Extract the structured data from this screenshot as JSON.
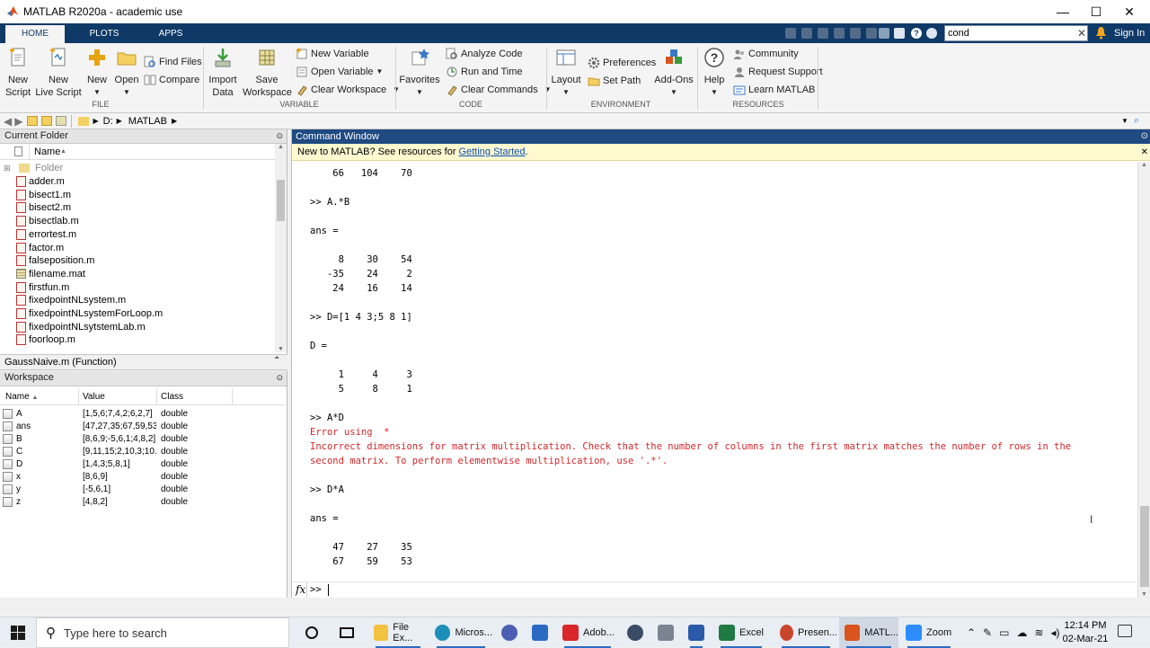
{
  "window": {
    "title": "MATLAB R2020a - academic use"
  },
  "tabs": [
    {
      "label": "HOME"
    },
    {
      "label": "PLOTS"
    },
    {
      "label": "APPS"
    }
  ],
  "search": {
    "value": "cond",
    "signin": "Sign In"
  },
  "ribbon": {
    "new_script": "New\nScript",
    "new_live_script": "New\nLive Script",
    "new": "New",
    "open": "Open",
    "find_files": "Find Files",
    "compare": "Compare",
    "import_data": "Import\nData",
    "save_workspace": "Save\nWorkspace",
    "new_variable": "New Variable",
    "open_variable": "Open Variable",
    "clear_workspace": "Clear Workspace",
    "favorites": "Favorites",
    "analyze_code": "Analyze Code",
    "run_and_time": "Run and Time",
    "clear_commands": "Clear Commands",
    "layout": "Layout",
    "preferences": "Preferences",
    "set_path": "Set Path",
    "addons": "Add-Ons",
    "help": "Help",
    "community": "Community",
    "request_support": "Request Support",
    "learn_matlab": "Learn MATLAB",
    "sections": {
      "file": "FILE",
      "variable": "VARIABLE",
      "code": "CODE",
      "environment": "ENVIRONMENT",
      "resources": "RESOURCES"
    }
  },
  "address": {
    "drive": "D:",
    "folder": "MATLAB"
  },
  "current_folder": {
    "title": "Current Folder",
    "name_col": "Name",
    "folder_item": "Folder",
    "files": [
      "adder.m",
      "bisect1.m",
      "bisect2.m",
      "bisectlab.m",
      "errortest.m",
      "factor.m",
      "falseposition.m",
      "filename.mat",
      "firstfun.m",
      "fixedpointNLsystem.m",
      "fixedpointNLsystemForLoop.m",
      "fixedpointNLsytstemLab.m",
      "foorloop.m"
    ]
  },
  "details": {
    "text": "GaussNaive.m  (Function)"
  },
  "workspace": {
    "title": "Workspace",
    "headers": {
      "name": "Name",
      "value": "Value",
      "class": "Class"
    },
    "vars": [
      {
        "name": "A",
        "value": "[1,5,6;7,4,2;6,2,7]",
        "class": "double"
      },
      {
        "name": "ans",
        "value": "[47,27,35;67,59,53]",
        "class": "double"
      },
      {
        "name": "B",
        "value": "[8,6,9;-5,6,1;4,8,2]",
        "class": "double"
      },
      {
        "name": "C",
        "value": "[9,11,15;2,10,3;10...",
        "class": "double"
      },
      {
        "name": "D",
        "value": "[1,4,3;5,8,1]",
        "class": "double"
      },
      {
        "name": "x",
        "value": "[8,6,9]",
        "class": "double"
      },
      {
        "name": "y",
        "value": "[-5,6,1]",
        "class": "double"
      },
      {
        "name": "z",
        "value": "[4,8,2]",
        "class": "double"
      }
    ]
  },
  "command_window": {
    "title": "Command Window",
    "notice_text": "New to MATLAB? See resources for ",
    "notice_link": "Getting Started",
    "notice_end": ".",
    "lines": [
      {
        "t": "    66   104    70",
        "err": false
      },
      {
        "t": ">> A.*B",
        "err": false
      },
      {
        "t": "ans =",
        "err": false
      },
      {
        "t": "     8    30    54",
        "err": false
      },
      {
        "t": "   -35    24     2",
        "err": false
      },
      {
        "t": "    24    16    14",
        "err": false
      },
      {
        "t": ">> D=[1 4 3;5 8 1]",
        "err": false
      },
      {
        "t": "D =",
        "err": false
      },
      {
        "t": "     1     4     3",
        "err": false
      },
      {
        "t": "     5     8     1",
        "err": false
      },
      {
        "t": ">> A*D",
        "err": false
      },
      {
        "t": "Error using  *",
        "err": true
      },
      {
        "t": "Incorrect dimensions for matrix multiplication. Check that the number of columns in the first matrix matches the number of rows in the",
        "err": true
      },
      {
        "t": "second matrix. To perform elementwise multiplication, use '.*'.",
        "err": true
      },
      {
        "t": ">> D*A",
        "err": false
      },
      {
        "t": "ans =",
        "err": false
      },
      {
        "t": "    47    27    35",
        "err": false
      },
      {
        "t": "    67    59    53",
        "err": false
      }
    ],
    "prompt_fx": "fx",
    "prompt": ">>"
  },
  "taskbar": {
    "search_placeholder": "Type here to search",
    "apps": [
      "File Ex...",
      "Micros...",
      "Adob...",
      "Excel",
      "Presen...",
      "MATL...",
      "Zoom"
    ],
    "time": "12:14 PM",
    "date": "02-Mar-21"
  },
  "colors": {
    "tabbar": "#0f3a68",
    "cmd_header": "#1f4a82",
    "error": "#d0282b",
    "link": "#0d4fb5"
  }
}
